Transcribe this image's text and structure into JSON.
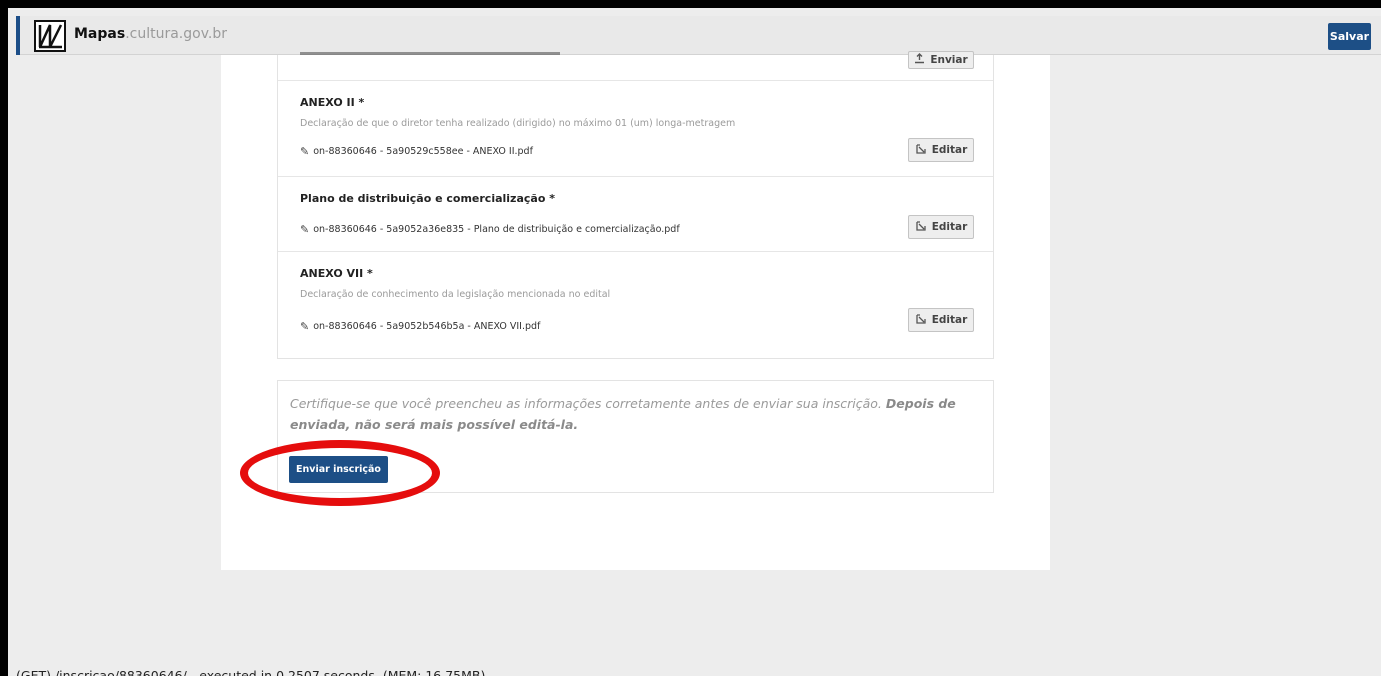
{
  "header": {
    "brand_bold": "Mapas",
    "brand_rest": ".cultura.gov.br",
    "save_label": "Salvar",
    "logo_icon": "mapas-logo-icon"
  },
  "attachments": [
    {
      "title": "",
      "description": "",
      "file": "",
      "button_label": "Enviar",
      "button_icon": "upload-icon"
    },
    {
      "title": "ANEXO II *",
      "description": "Declaração de que o diretor tenha realizado (dirigido) no máximo 01 (um) longa-metragem",
      "file": "on-88360646 - 5a90529c558ee - ANEXO II.pdf",
      "button_label": "Editar",
      "button_icon": "edit-icon"
    },
    {
      "title": "Plano de distribuição e comercialização *",
      "description": "",
      "file": "on-88360646 - 5a9052a36e835 - Plano de distribuição e comercialização.pdf",
      "button_label": "Editar",
      "button_icon": "edit-icon"
    },
    {
      "title": "ANEXO VII *",
      "description": "Declaração de conhecimento da legislação mencionada no edital",
      "file": "on-88360646 - 5a9052b546b5a - ANEXO VII.pdf",
      "button_label": "Editar",
      "button_icon": "edit-icon"
    }
  ],
  "confirm": {
    "text_normal": "Certifique-se que você preencheu as informações corretamente antes de enviar sua inscrição.",
    "text_bold": "Depois de enviada, não será mais possível editá-la.",
    "submit_label": "Enviar inscrição"
  },
  "footer": {
    "debug_text": "(GET) /inscricao/88360646/ - executed in 0.2507 seconds. (MEM: 16.75MB)"
  },
  "colors": {
    "primary": "#1d4f86",
    "highlight": "#e50d0d"
  }
}
